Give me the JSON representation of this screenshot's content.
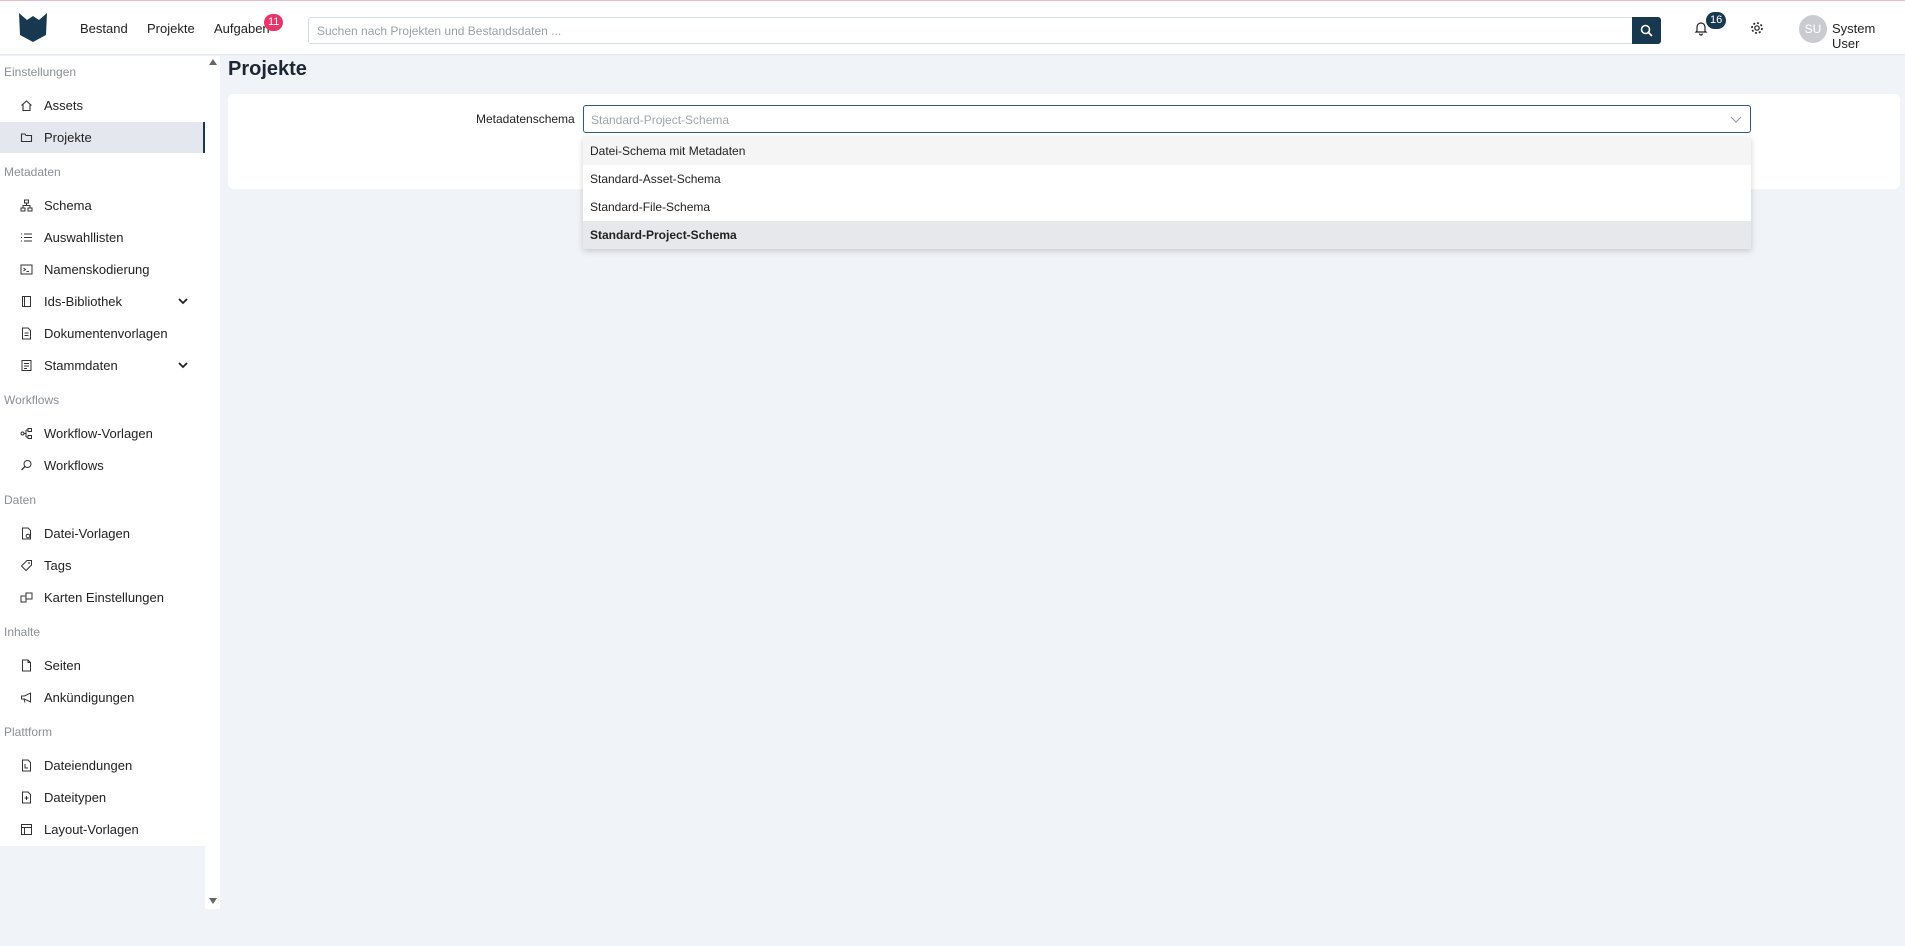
{
  "header": {
    "nav": [
      "Bestand",
      "Projekte",
      "Aufgaben"
    ],
    "tasks_badge": "11",
    "search_placeholder": "Suchen nach Projekten und Bestandsdaten ...",
    "notifications_badge": "16",
    "user_initials": "SU",
    "user_name": "System User",
    "brand_color": "#17384f",
    "badge_color": "#e8346a"
  },
  "sidebar": {
    "sections": [
      {
        "title": "Einstellungen",
        "items": [
          {
            "label": "Assets",
            "icon": "home-icon"
          },
          {
            "label": "Projekte",
            "icon": "folder-icon",
            "active": true
          }
        ]
      },
      {
        "title": "Metadaten",
        "items": [
          {
            "label": "Schema",
            "icon": "schema-icon"
          },
          {
            "label": "Auswahllisten",
            "icon": "list-icon"
          },
          {
            "label": "Namenskodierung",
            "icon": "terminal-icon"
          },
          {
            "label": "Ids-Bibliothek",
            "icon": "book-icon",
            "expandable": true
          },
          {
            "label": "Dokumentenvorlagen",
            "icon": "document-icon"
          },
          {
            "label": "Stammdaten",
            "icon": "database-icon",
            "expandable": true
          }
        ]
      },
      {
        "title": "Workflows",
        "items": [
          {
            "label": "Workflow-Vorlagen",
            "icon": "workflow-icon"
          },
          {
            "label": "Workflows",
            "icon": "workflow-search-icon"
          }
        ]
      },
      {
        "title": "Daten",
        "items": [
          {
            "label": "Datei-Vorlagen",
            "icon": "file-template-icon"
          },
          {
            "label": "Tags",
            "icon": "tag-icon"
          },
          {
            "label": "Karten Einstellungen",
            "icon": "map-settings-icon"
          }
        ]
      },
      {
        "title": "Inhalte",
        "items": [
          {
            "label": "Seiten",
            "icon": "page-icon"
          },
          {
            "label": "Ankündigungen",
            "icon": "megaphone-icon"
          }
        ]
      },
      {
        "title": "Plattform",
        "items": [
          {
            "label": "Dateiendungen",
            "icon": "file-extension-icon"
          },
          {
            "label": "Dateitypen",
            "icon": "file-type-icon"
          },
          {
            "label": "Layout-Vorlagen",
            "icon": "layout-icon"
          }
        ]
      }
    ]
  },
  "main": {
    "title": "Projekte",
    "field_label": "Metadatenschema",
    "select_value": "Standard-Project-Schema",
    "options": [
      "Datei-Schema mit Metadaten",
      "Standard-Asset-Schema",
      "Standard-File-Schema",
      "Standard-Project-Schema"
    ],
    "selected_option": "Standard-Project-Schema"
  }
}
